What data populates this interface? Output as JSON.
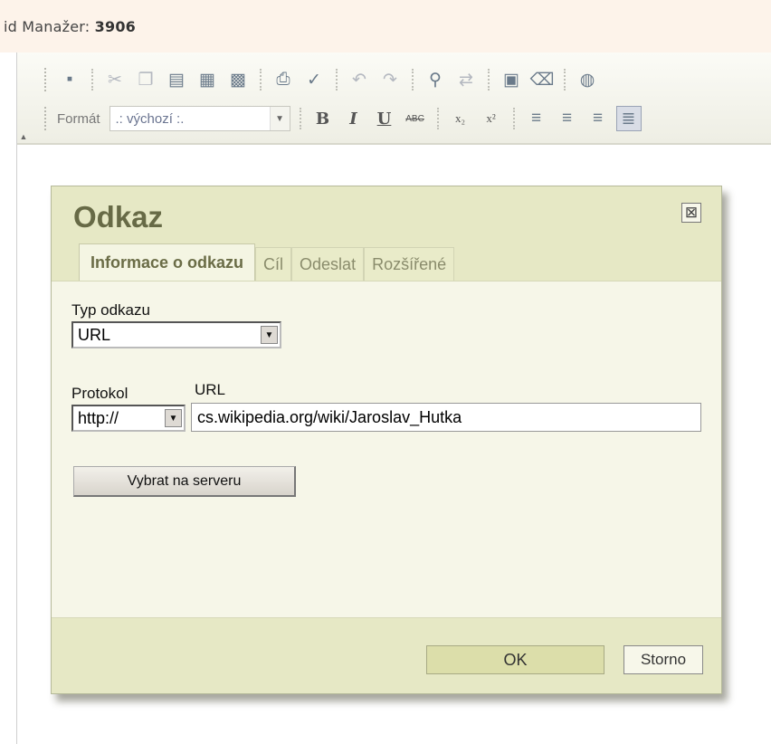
{
  "manager": {
    "label": "id Manažer:",
    "id_value": "3906"
  },
  "toolbar": {
    "row1_icons": [
      "save-icon",
      "cut-icon",
      "copy-icon",
      "paste-icon",
      "paste-text-icon",
      "paste-word-icon",
      "print-icon",
      "spellcheck-icon",
      "undo-icon",
      "redo-icon",
      "find-icon",
      "replace-icon",
      "select-all-icon",
      "remove-format-icon",
      "link-icon"
    ],
    "format_label": "Formát",
    "format_value": ".: výchozí :.",
    "bold": "B",
    "italic": "I",
    "underline": "U",
    "strike": "ABC",
    "subscript": "x₂",
    "superscript": "x²"
  },
  "dialog": {
    "title": "Odkaz",
    "close_symbol": "⊠",
    "tabs": [
      "Informace o odkazu",
      "Cíl",
      "Odeslat",
      "Rozšířené"
    ],
    "link_type_label": "Typ odkazu",
    "link_type_value": "URL",
    "protocol_label": "Protokol",
    "protocol_value": "http://",
    "url_label": "URL",
    "url_value": "cs.wikipedia.org/wiki/Jaroslav_Hutka",
    "browse_button": "Vybrat na serveru",
    "ok_button": "OK",
    "cancel_button": "Storno"
  },
  "colors": {
    "dialog_bg": "#eff0d4",
    "dialog_body": "#f6f6e8",
    "title_color": "#676a46",
    "header_strip": "#fdf3ea"
  }
}
